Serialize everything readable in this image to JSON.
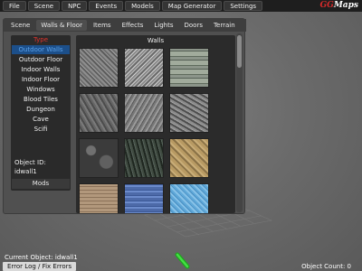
{
  "menu": [
    "File",
    "Scene",
    "NPC",
    "Events",
    "Models",
    "Map Generator",
    "Settings"
  ],
  "logo": {
    "part1": "GG",
    "part2": "Maps"
  },
  "tabs": [
    "Scene",
    "Walls & Floor",
    "Items",
    "Effects",
    "Lights",
    "Doors",
    "Terrain"
  ],
  "active_tab": "Walls & Floor",
  "type_panel": {
    "heading": "Type",
    "items": [
      "Outdoor Walls",
      "Outdoor Floor",
      "Indoor Walls",
      "Indoor Floor",
      "Windows",
      "Blood Tiles",
      "Dungeon",
      "Cave",
      "Scifi"
    ],
    "selected": "Outdoor Walls",
    "object_id_label": "Object ID:",
    "object_id_value": "idwall1",
    "mods_label": "Mods"
  },
  "grid": {
    "heading": "Walls"
  },
  "status": {
    "current_object": "Current Object: idwall1",
    "error_log_label": "Error Log / Fix Errors",
    "object_count": "Object Count: 0"
  },
  "colors": {
    "accent": "#1c4f8a",
    "type_heading": "#e0332c",
    "gizmo": "#2fd12f"
  }
}
